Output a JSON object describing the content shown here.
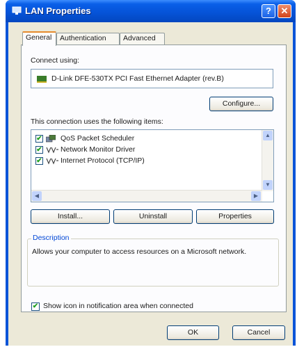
{
  "window": {
    "title": "LAN Properties",
    "help_symbol": "?",
    "close_symbol": "✕",
    "icon": "network-connection-icon"
  },
  "tabs": [
    {
      "label": "General",
      "active": true
    },
    {
      "label": "Authentication",
      "active": false
    },
    {
      "label": "Advanced",
      "active": false
    }
  ],
  "general": {
    "connect_using_label": "Connect using:",
    "adapter_name": "D-Link DFE-530TX PCI Fast Ethernet Adapter (rev.B)",
    "configure_label": "Configure...",
    "items_label": "This connection uses the following items:",
    "items": [
      {
        "label": "QoS Packet Scheduler",
        "checked": true,
        "icon": "scheduler-icon"
      },
      {
        "label": "Network Monitor Driver",
        "checked": true,
        "icon": "protocol-icon"
      },
      {
        "label": "Internet Protocol (TCP/IP)",
        "checked": true,
        "icon": "protocol-icon"
      }
    ],
    "install_label": "Install...",
    "uninstall_label": "Uninstall",
    "properties_label": "Properties",
    "description_title": "Description",
    "description_text": "Allows your computer to access resources on a Microsoft network.",
    "notify_label": "Show icon in notification area when connected",
    "notify_checked": true
  },
  "footer": {
    "ok_label": "OK",
    "cancel_label": "Cancel"
  },
  "colors": {
    "titlebar": "#0552d6",
    "dialog_face": "#ece9d8",
    "active_tab_accent": "#e68b2c",
    "check_mark": "#21a121",
    "group_title": "#0046d5"
  }
}
